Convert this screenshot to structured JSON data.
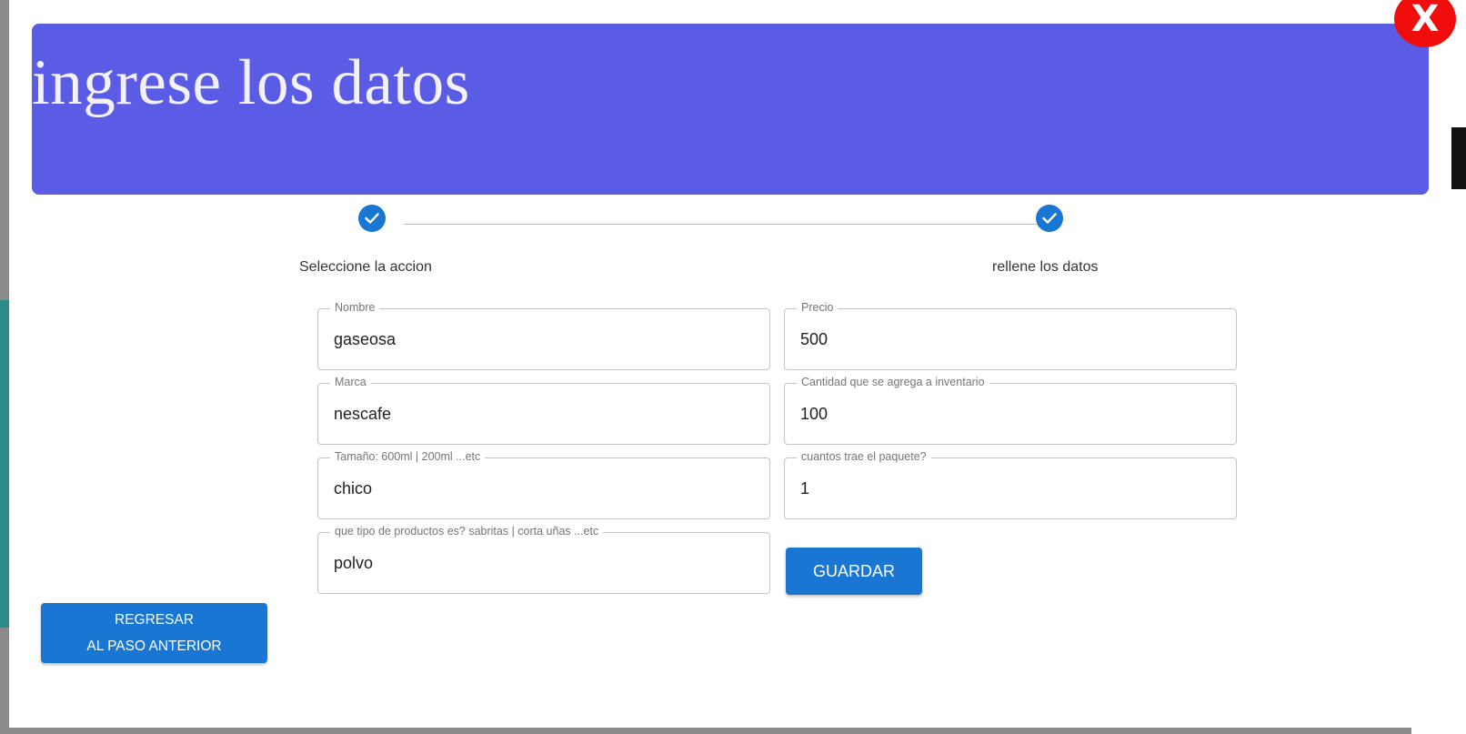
{
  "header": {
    "title": "ingrese los datos"
  },
  "close_button": {
    "label": "X"
  },
  "stepper": {
    "steps": [
      {
        "label": "Seleccione la accion",
        "completed": true
      },
      {
        "label": "rellene los datos",
        "completed": true
      }
    ]
  },
  "form": {
    "nombre": {
      "label": "Nombre",
      "value": "gaseosa"
    },
    "precio": {
      "label": "Precio",
      "value": "500"
    },
    "marca": {
      "label": "Marca",
      "value": "nescafe"
    },
    "cantidad": {
      "label": "Cantidad que se agrega a inventario",
      "value": "100"
    },
    "tamano": {
      "label": "Tamaño: 600ml | 200ml ...etc",
      "value": "chico"
    },
    "paquete": {
      "label": "cuantos trae el paquete?",
      "value": "1"
    },
    "tipo": {
      "label": "que tipo de productos es? sabritas | corta uñas ...etc",
      "value": "polvo"
    }
  },
  "buttons": {
    "save": "GUARDAR",
    "back_line1": "REGRESAR",
    "back_line2": "AL PASO ANTERIOR"
  },
  "colors": {
    "header_bg": "#5a5ce6",
    "primary": "#1976d2",
    "close": "#f20d0d"
  },
  "icons": {
    "step_done": "check-icon",
    "close": "close-icon"
  }
}
